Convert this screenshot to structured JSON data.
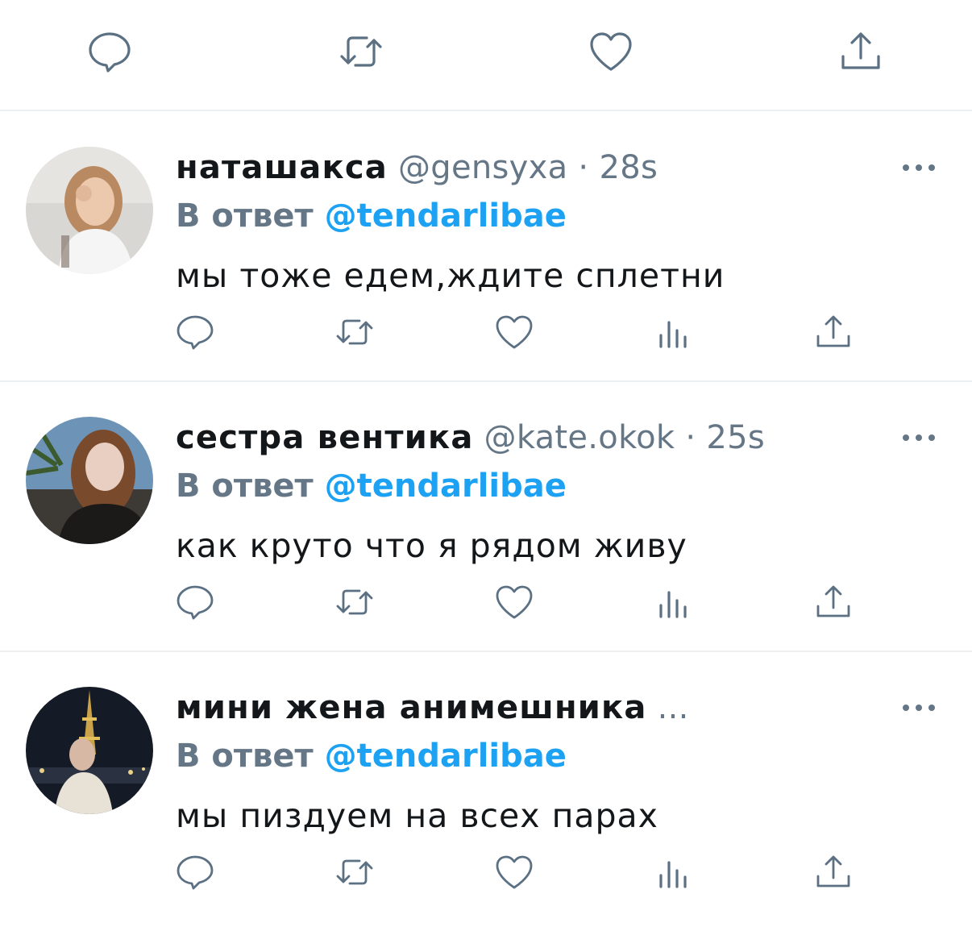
{
  "colors": {
    "text": "#14171a",
    "secondary": "#657786",
    "mention": "#1da1f2",
    "divider": "#eceff1",
    "icon": "#5b7083"
  },
  "top_actions": [
    "reply-icon",
    "retweet-icon",
    "like-icon",
    "share-icon"
  ],
  "reply_actions": [
    "reply-icon",
    "retweet-icon",
    "like-icon",
    "analytics-icon",
    "share-icon"
  ],
  "reply_to_label": "В ответ",
  "replies": [
    {
      "display_name": "наташакса",
      "handle": "@gensyxa",
      "separator": "·",
      "time": "28s",
      "mention": "@tendarlibae",
      "text": "мы тоже едем,ждите сплетни"
    },
    {
      "display_name": "сестра вентика",
      "handle": "@kate.okok",
      "separator": "·",
      "time": "25s",
      "mention": "@tendarlibae",
      "text": "как круто что я рядом живу"
    },
    {
      "display_name": "мини жена анимешника",
      "truncation": "...",
      "mention": "@tendarlibae",
      "text": "мы пиздуем на всех парах"
    }
  ]
}
